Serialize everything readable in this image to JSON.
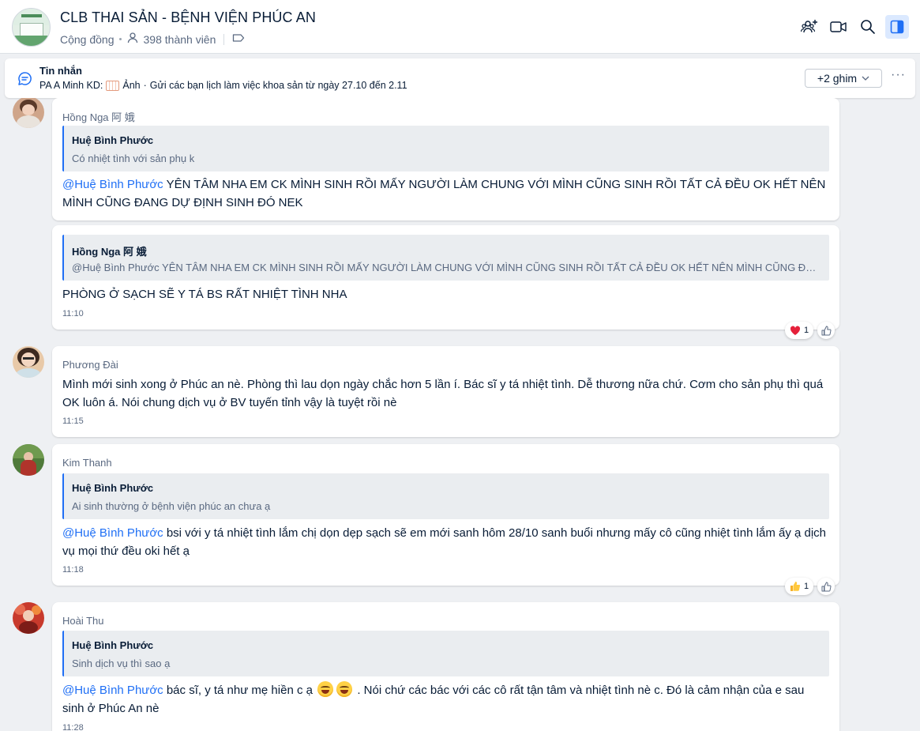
{
  "header": {
    "title": "CLB THAI SẢN - BỆNH VIỆN PHÚC AN",
    "type_label": "Cộng đồng",
    "members": "398 thành viên",
    "icons": [
      "add-member-icon",
      "video-call-icon",
      "search-icon",
      "sidebar-toggle-icon"
    ],
    "accent": "#1f6ff5"
  },
  "pinned": {
    "title": "Tin nhắn",
    "sender": "PA A Minh KD:",
    "attachment": "Ảnh",
    "text": "Gửi các bạn lịch làm việc khoa sản từ ngày 27.10 đến 2.11",
    "pin_count": "+2 ghim",
    "more": "···"
  },
  "messages": [
    {
      "sender": "Hồng Nga 阿 娥",
      "quote_name": "Huệ Bình Phước",
      "quote_text": "Có nhiệt tình với sản phụ k",
      "mention": "@Huệ Bình Phước",
      "text": " YÊN TÂM NHA EM CK MÌNH SINH RỒI MẤY NGƯỜI LÀM CHUNG VỚI MÌNH CŨNG SINH RỒI TẤT CẢ ĐỀU OK HẾT NÊN MÌNH CŨNG ĐANG DỰ ĐỊNH SINH ĐÓ NEK"
    },
    {
      "quote_name": "Hồng Nga 阿 娥",
      "quote_text": "@Huệ Bình Phước YÊN TÂM NHA EM CK MÌNH SINH RỒI MẤY NGƯỜI LÀM CHUNG VỚI MÌNH CŨNG SINH RỒI TẤT CẢ ĐỀU OK HẾT NÊN MÌNH CŨNG ĐANG DỰ ĐỊNH SINH ĐÓ NEK",
      "text": "PHÒNG Ở SẠCH SẼ Y TÁ BS RẤT NHIỆT TÌNH NHA",
      "time": "11:10",
      "reaction_count": "1"
    },
    {
      "sender": "Phương Đài",
      "text": "Mình mới sinh xong ở Phúc an nè. Phòng thì lau dọn ngày chắc hơn 5 lần í. Bác sĩ y tá nhiệt tình. Dễ thương nữa chứ. Cơm cho sản phụ thì quá OK luôn á. Nói chung dịch vụ ở BV tuyến tỉnh vậy là tuyệt rồi nè",
      "time": "11:15"
    },
    {
      "sender": "Kim Thanh",
      "quote_name": "Huệ Bình Phước",
      "quote_text": "Ai sinh thường ở bệnh viện phúc an chưa ạ",
      "mention": "@Huệ Bình Phước",
      "text": " bsi với y tá nhiệt tình lắm chị dọn dẹp sạch sẽ em mới sanh hôm 28/10 sanh buổi nhưng mấy cô cũng nhiệt tình lắm ấy ạ dịch vụ mọi thứ đều oki hết ạ",
      "time": "11:18",
      "reaction_count": "1"
    },
    {
      "sender": "Hoài Thu",
      "quote_name": "Huệ Bình Phước",
      "quote_text": "Sinh dịch vụ thì sao ạ",
      "mention": "@Huệ Bình Phước",
      "text_a": " bác sĩ, y tá như mẹ hiền c ạ ",
      "text_b": " . Nói chứ các bác với các cô rất tận tâm và nhiệt tình nè c. Đó là cảm nhận của e sau sinh ở Phúc An nè",
      "time": "11:28"
    }
  ]
}
